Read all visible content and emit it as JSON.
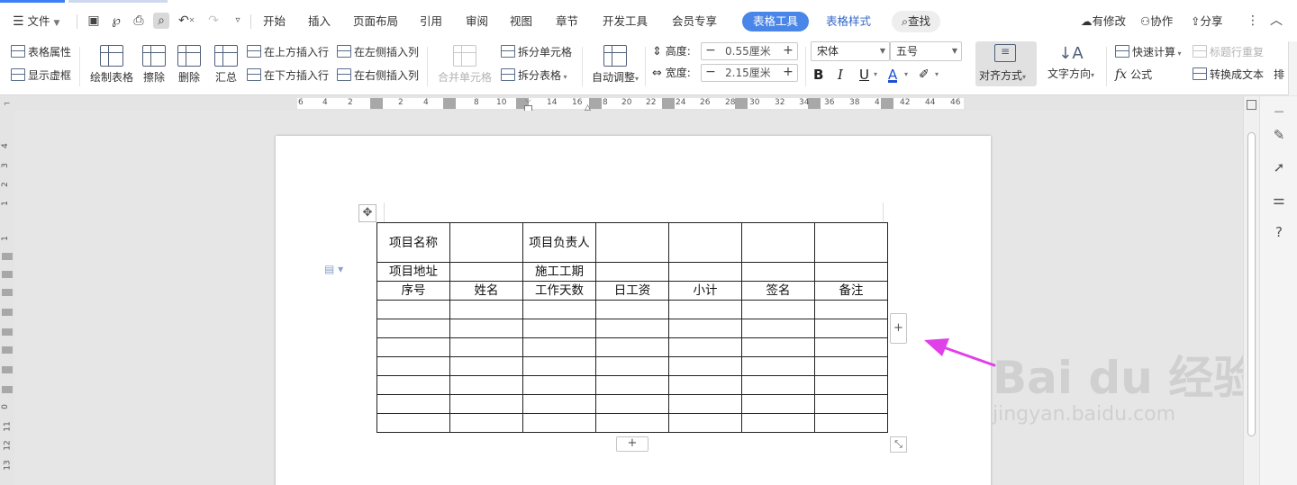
{
  "menubar": {
    "file_label": "文件",
    "tabs": [
      "开始",
      "插入",
      "页面布局",
      "引用",
      "审阅",
      "视图",
      "章节",
      "开发工具",
      "会员专享",
      "表格工具",
      "表格样式"
    ],
    "search_label": "查找",
    "right": [
      "有修改",
      "协作",
      "分享"
    ]
  },
  "ribbon": {
    "table_props": "表格属性",
    "show_gridlines": "显示虚框",
    "draw_table": "绘制表格",
    "erase": "擦除",
    "delete": "删除",
    "summary": "汇总",
    "insert_above": "在上方插入行",
    "insert_below": "在下方插入行",
    "insert_left": "在左侧插入列",
    "insert_right": "在右侧插入列",
    "merge_cells": "合并单元格",
    "split_cells": "拆分单元格",
    "split_table": "拆分表格",
    "auto_fit": "自动调整",
    "height_label": "高度:",
    "height_value": "0.55厘米",
    "width_label": "宽度:",
    "width_value": "2.15厘米",
    "font_name": "宋体",
    "font_size": "五号",
    "bold": "B",
    "italic": "I",
    "underline": "U",
    "font_color": "A",
    "align": "对齐方式",
    "text_direction": "文字方向",
    "quick_calc": "快速计算",
    "formula": "公式",
    "repeat_header": "标题行重复",
    "convert_text": "转换成文本",
    "more": "排"
  },
  "hruler": {
    "labels": [
      "6",
      "4",
      "2",
      "2",
      "4",
      "8",
      "10",
      "14",
      "16",
      "8",
      "20",
      "22",
      "24",
      "26",
      "28",
      "30",
      "32",
      "34",
      "36",
      "38",
      "4",
      "42",
      "44",
      "46"
    ]
  },
  "vruler": {
    "labels": [
      "4",
      "3",
      "2",
      "1",
      "1",
      "0",
      "11",
      "12",
      "13"
    ]
  },
  "table": {
    "rows": [
      [
        "项目名称",
        "",
        "项目负责人",
        "",
        "",
        "",
        ""
      ],
      [
        "项目地址",
        "",
        "施工工期",
        "",
        "",
        "",
        ""
      ],
      [
        "序号",
        "姓名",
        "工作天数",
        "日工资",
        "小计",
        "签名",
        "备注"
      ],
      [
        "",
        "",
        "",
        "",
        "",
        "",
        ""
      ],
      [
        "",
        "",
        "",
        "",
        "",
        "",
        ""
      ],
      [
        "",
        "",
        "",
        "",
        "",
        "",
        ""
      ],
      [
        "",
        "",
        "",
        "",
        "",
        "",
        ""
      ],
      [
        "",
        "",
        "",
        "",
        "",
        "",
        ""
      ],
      [
        "",
        "",
        "",
        "",
        "",
        "",
        ""
      ],
      [
        "",
        "",
        "",
        "",
        "",
        "",
        ""
      ]
    ]
  },
  "watermark": {
    "logo_text": "Bai du 经验",
    "url": "jingyan.baidu.com"
  },
  "colors": {
    "accent": "#4a86e8",
    "arrow": "#e040e8"
  }
}
